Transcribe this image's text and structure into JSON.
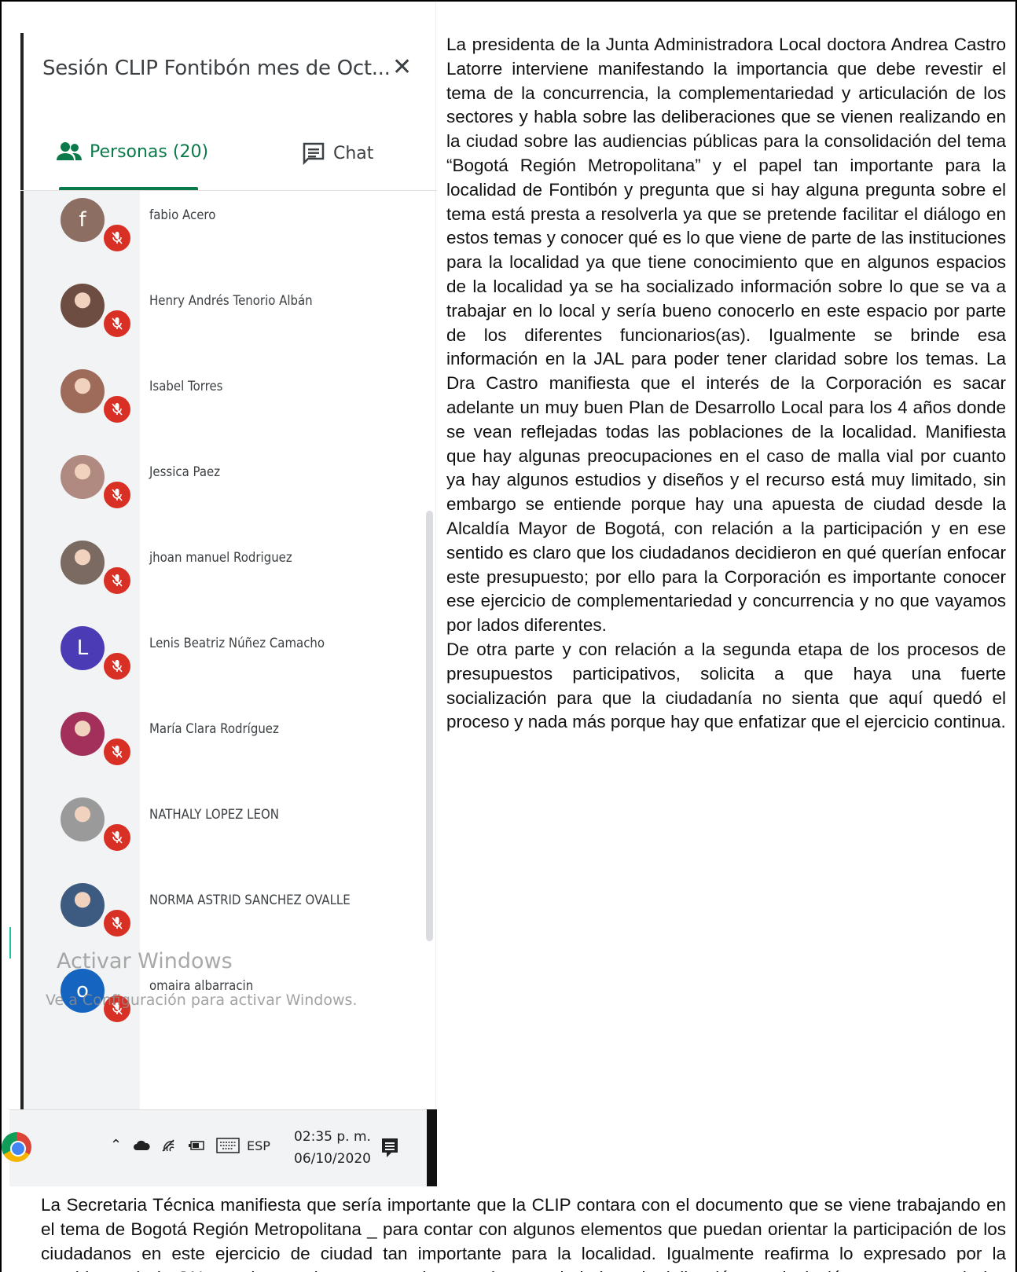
{
  "meet": {
    "title": "Sesión CLIP Fontibón mes de Oct...",
    "tabs": [
      {
        "label": "Personas (20)",
        "icon": "people-icon"
      },
      {
        "label": "Chat",
        "icon": "chat-icon"
      }
    ],
    "participants": [
      {
        "name": "fabio Acero",
        "initial": "f",
        "avatar_color": "#8d6e63"
      },
      {
        "name": "Henry Andrés Tenorio Albán",
        "initial": "",
        "avatar_color": "#6d4c41"
      },
      {
        "name": "Isabel Torres",
        "initial": "",
        "avatar_color": "#9e6b5a"
      },
      {
        "name": "Jessica Paez",
        "initial": "",
        "avatar_color": "#b08a80"
      },
      {
        "name": "jhoan manuel Rodriguez",
        "initial": "",
        "avatar_color": "#7b6a62"
      },
      {
        "name": "Lenis Beatriz Núñez Camacho",
        "initial": "L",
        "avatar_color": "#4b3bb5"
      },
      {
        "name": "María Clara Rodríguez",
        "initial": "",
        "avatar_color": "#a3305a"
      },
      {
        "name": "NATHALY LOPEZ LEON",
        "initial": "",
        "avatar_color": "#9a9a9a"
      },
      {
        "name": "NORMA ASTRID SANCHEZ OVALLE",
        "initial": "",
        "avatar_color": "#3d5a80"
      },
      {
        "name": "omaira albarracin",
        "initial": "o",
        "avatar_color": "#1565c0"
      }
    ],
    "watermark": {
      "title": "Activar Windows",
      "subtitle": "Ve a Configuración para activar Windows."
    },
    "taskbar": {
      "language": "ESP",
      "time": "02:35 p. m.",
      "date": "06/10/2020"
    },
    "colors": {
      "accent": "#0b7a4b",
      "mic_off": "#d93025"
    }
  },
  "document": {
    "right_paragraphs": [
      " La presidenta de la Junta Administradora Local doctora Andrea Castro Latorre interviene manifestando la importancia que debe revestir el tema de la concurrencia, la complementariedad y articulación de los sectores y habla sobre las deliberaciones que se vienen realizando en la ciudad sobre las audiencias públicas para la consolidación del tema “Bogotá Región Metropolitana” y el papel tan importante para la localidad de Fontibón y pregunta que si hay alguna pregunta sobre el tema está presta a resolverla ya que se pretende facilitar el diálogo en estos temas y conocer qué es lo que viene de parte de las instituciones para la localidad ya que tiene conocimiento que en algunos espacios de la localidad ya se ha socializado información sobre lo que se va a trabajar en lo local y sería bueno conocerlo  en este espacio por parte de los diferentes funcionarios(as). Igualmente se brinde esa información en la JAL para poder tener claridad sobre los temas. La Dra Castro manifiesta que el interés de la Corporación es sacar adelante un muy buen Plan de Desarrollo Local para los 4 años donde se vean reflejadas todas las poblaciones de la localidad. Manifiesta que hay algunas preocupaciones en el caso de malla vial por cuanto ya hay algunos estudios y diseños y el recurso está muy limitado, sin embargo se entiende porque hay una apuesta de ciudad desde la Alcaldía Mayor de Bogotá,  con relación a la participación y en ese sentido es claro que los ciudadanos decidieron en qué querían enfocar este presupuesto; por ello para la Corporación es importante conocer ese ejercicio de complementariedad y concurrencia y no que vayamos por lados diferentes.",
      "De otra parte y con relación a la segunda etapa de los procesos de presupuestos participativos, solicita a que haya una fuerte socialización para que la ciudadanía no sienta que aquí quedó el proceso y nada más porque hay que enfatizar que el ejercicio continua."
    ],
    "bottom_paragraph": "La Secretaria Técnica manifiesta que sería importante que la CLIP contara con el documento que se viene trabajando en el tema de  Bogotá Región Metropolitana _ para contar con algunos elementos que puedan orientar la participación de los ciudadanos en este ejercicio de ciudad tan importante para la localidad. Igualmente reafirma lo expresado por la presidenta de la JAL en el tema de concurrencia, complementariedad, territorialización y articulación ya que una de las razones de ser de la CLIP es articular los procesos que del centro vienen a la localidad"
  }
}
